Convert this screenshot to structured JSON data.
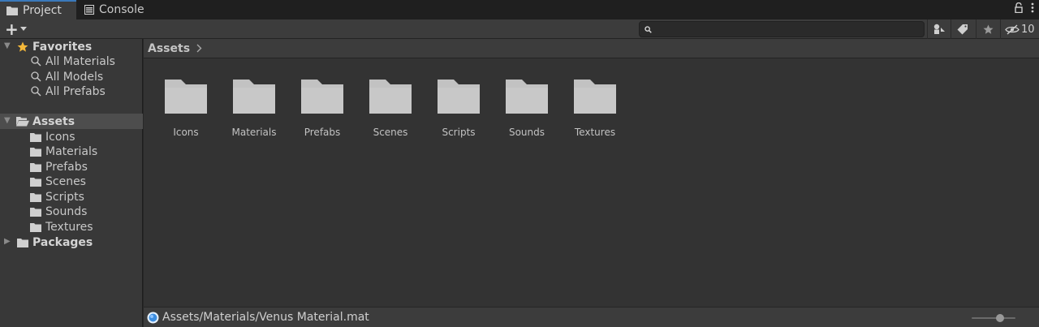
{
  "tabs": [
    {
      "label": "Project",
      "icon": "folder-icon",
      "active": true
    },
    {
      "label": "Console",
      "icon": "console-icon",
      "active": false
    }
  ],
  "toolbar": {
    "create_label": "+",
    "search_placeholder": "",
    "search_value": "",
    "hidden_count": "10"
  },
  "sidebar": {
    "favorites": {
      "label": "Favorites",
      "items": [
        "All Materials",
        "All Models",
        "All Prefabs"
      ]
    },
    "assets": {
      "label": "Assets",
      "items": [
        "Icons",
        "Materials",
        "Prefabs",
        "Scenes",
        "Scripts",
        "Sounds",
        "Textures"
      ]
    },
    "packages": {
      "label": "Packages"
    }
  },
  "breadcrumb": {
    "root": "Assets"
  },
  "grid": {
    "folders": [
      "Icons",
      "Materials",
      "Prefabs",
      "Scenes",
      "Scripts",
      "Sounds",
      "Textures"
    ]
  },
  "status": {
    "path": "Assets/Materials/Venus Material.mat"
  },
  "colors": {
    "accent": "#3a79bb",
    "folder": "#c2c2c2",
    "star": "#f4b83a"
  }
}
